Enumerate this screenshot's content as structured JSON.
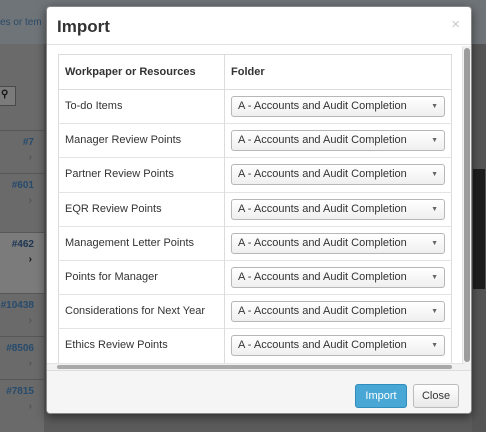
{
  "background": {
    "breadcrumb_text": "es or tem",
    "search_icon": "search-icon",
    "list_items": [
      {
        "id": "#7"
      },
      {
        "id": "#601"
      },
      {
        "id": "#462",
        "active": true
      },
      {
        "id": "#10438"
      },
      {
        "id": "#8506"
      },
      {
        "id": "#7815"
      }
    ]
  },
  "modal": {
    "title": "Import",
    "close_glyph": "×",
    "table": {
      "headers": [
        "Workpaper or Resources",
        "Folder"
      ],
      "rows": [
        {
          "resource": "To-do Items",
          "folder": "A - Accounts and Audit Completion"
        },
        {
          "resource": "Manager Review Points",
          "folder": "A - Accounts and Audit Completion"
        },
        {
          "resource": "Partner Review Points",
          "folder": "A - Accounts and Audit Completion"
        },
        {
          "resource": "EQR Review Points",
          "folder": "A - Accounts and Audit Completion"
        },
        {
          "resource": "Management Letter Points",
          "folder": "A - Accounts and Audit Completion"
        },
        {
          "resource": "Points for Manager",
          "folder": "A - Accounts and Audit Completion"
        },
        {
          "resource": "Considerations for Next Year",
          "folder": "A - Accounts and Audit Completion"
        },
        {
          "resource": "Ethics Review Points",
          "folder": "A - Accounts and Audit Completion"
        }
      ]
    },
    "footer": {
      "import_label": "Import",
      "close_label": "Close"
    }
  },
  "colors": {
    "primary_button": "#49a7d6",
    "overlay": "#5b5b5b"
  }
}
